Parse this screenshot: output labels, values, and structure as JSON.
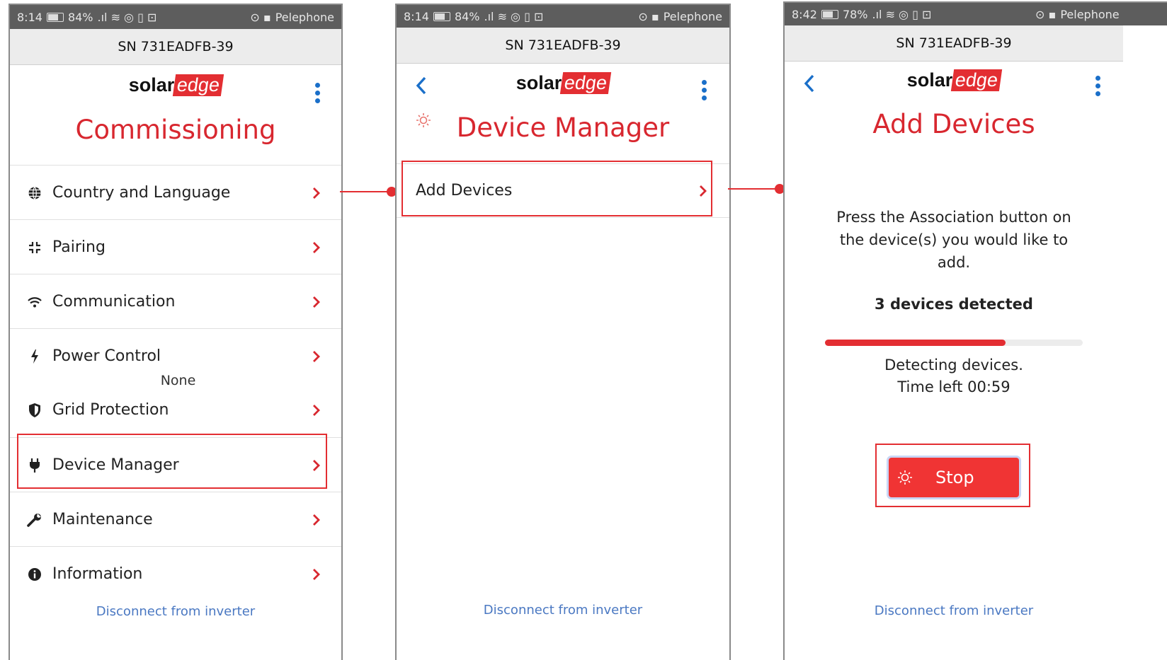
{
  "screens": [
    {
      "status": {
        "time": "8:14",
        "battery": "84%",
        "carrier": "Pelephone"
      },
      "serial": "SN 731EADFB-39",
      "logo": {
        "solar": "solar",
        "edge": "edge"
      },
      "title": "Commissioning",
      "menu": [
        {
          "label": "Country and Language",
          "icon": "globe-icon"
        },
        {
          "label": "Pairing",
          "icon": "pairing-icon"
        },
        {
          "label": "Communication",
          "icon": "wifi-icon"
        },
        {
          "label": "Power Control",
          "icon": "bolt-icon"
        },
        {
          "label": "Grid Protection",
          "icon": "shield-icon"
        },
        {
          "label": "Device Manager",
          "icon": "plug-icon"
        },
        {
          "label": "Maintenance",
          "icon": "wrench-icon"
        },
        {
          "label": "Information",
          "icon": "info-icon"
        }
      ],
      "overlay_note": "None",
      "footer": "Disconnect from inverter"
    },
    {
      "status": {
        "time": "8:14",
        "battery": "84%",
        "carrier": "Pelephone"
      },
      "serial": "SN 731EADFB-39",
      "logo": {
        "solar": "solar",
        "edge": "edge"
      },
      "title": "Device Manager",
      "menu": [
        {
          "label": "Add Devices"
        }
      ],
      "footer": "Disconnect from inverter"
    },
    {
      "status": {
        "time": "8:42",
        "battery": "78%",
        "carrier": "Pelephone"
      },
      "serial": "SN 731EADFB-39",
      "logo": {
        "solar": "solar",
        "edge": "edge"
      },
      "title": "Add Devices",
      "instruction": "Press the Association button on the device(s) you would like to add.",
      "detected": "3 devices detected",
      "progress": 0.7,
      "detecting": "Detecting devices.",
      "time_left": "Time left 00:59",
      "stop_label": "Stop",
      "footer": "Disconnect from inverter"
    }
  ],
  "colors": {
    "accent": "#e32e32",
    "title_red": "#d8272f",
    "link_blue": "#4a78c2",
    "nav_blue": "#1a6fc9"
  }
}
